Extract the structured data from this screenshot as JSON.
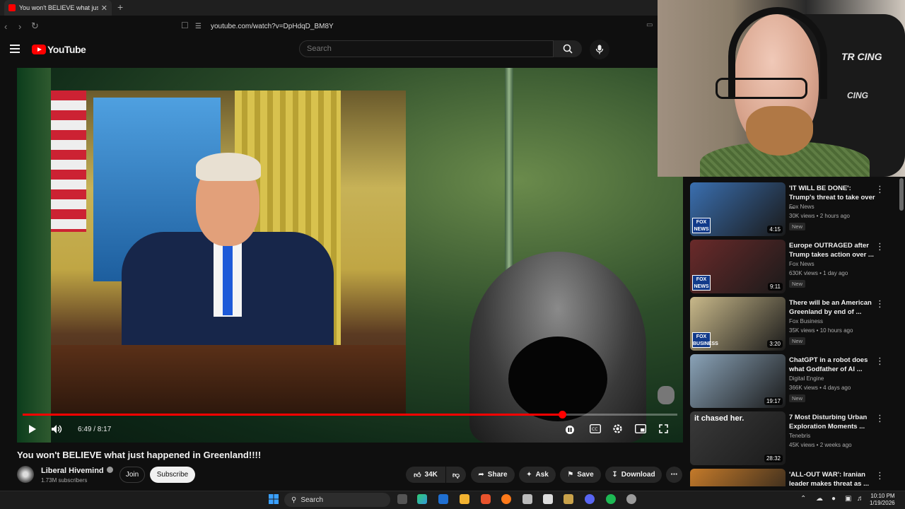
{
  "browser": {
    "tab_title": "You won't BELIEVE what just happened",
    "tab_close": "✕",
    "new_tab": "+",
    "url": "youtube.com/watch?v=DpHdqD_BM8Y"
  },
  "header": {
    "logo_text": "YouTube",
    "search_placeholder": "Search"
  },
  "player": {
    "time": "6:49 / 8:17",
    "progress": 0.824
  },
  "video": {
    "title": "You won't BELIEVE what just happened in Greenland!!!!",
    "channel": "Liberal Hivemind",
    "subscribers": "1.73M subscribers",
    "join_label": "Join",
    "subscribe_label": "Subscribe",
    "likes": "34K",
    "share_label": "Share",
    "ask_label": "Ask",
    "save_label": "Save",
    "download_label": "Download"
  },
  "webcam": {
    "chair_text_1": "TR CING",
    "chair_text_2": "CING"
  },
  "recommendations": [
    {
      "title": "'IT WILL BE DONE': Trump's threat to take over ...",
      "channel": "Fox News",
      "meta": "30K views • 2 hours ago",
      "badge": "New",
      "duration": "4:15",
      "logo": "FOX NEWS",
      "thumb_color": "#3a6fb0"
    },
    {
      "title": "Europe OUTRAGED after Trump takes action over ...",
      "channel": "Fox News",
      "meta": "630K views • 1 day ago",
      "badge": "New",
      "duration": "9:11",
      "logo": "FOX NEWS",
      "thumb_color": "#6a2a2a"
    },
    {
      "title": "There will be an American Greenland by end of ...",
      "channel": "Fox Business",
      "meta": "35K views • 10 hours ago",
      "badge": "New",
      "duration": "3:20",
      "logo": "FOX BUSINESS",
      "thumb_color": "#c9b98a"
    },
    {
      "title": "ChatGPT in a robot does what Godfather of AI ...",
      "channel": "Digital Engine",
      "meta": "366K views • 4 days ago",
      "badge": "New",
      "duration": "19:17",
      "logo": "",
      "thumb_color": "#8aa3b8"
    },
    {
      "title": "7 Most Disturbing Urban Exploration Moments ...",
      "channel": "Tenebris",
      "meta": "45K views • 2 weeks ago",
      "badge": "",
      "duration": "28:32",
      "logo": "",
      "thumb_color": "#3a3a3a",
      "overlay": "it chased her."
    },
    {
      "title": "'ALL-OUT WAR': Iranian leader makes threat as ...",
      "channel": "",
      "meta": "",
      "badge": "",
      "duration": "",
      "logo": "",
      "thumb_color": "#c47a2a"
    }
  ],
  "taskbar": {
    "search_label": "Search",
    "time": "10:10 PM",
    "date": "1/19/2026"
  }
}
